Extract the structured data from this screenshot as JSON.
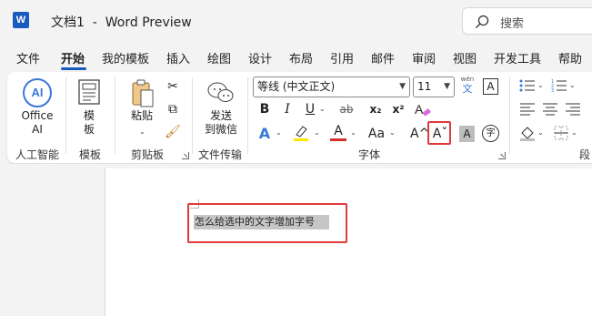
{
  "titlebar": {
    "logo_letter": "W",
    "title": "文档1  -  Word Preview",
    "search_placeholder": "搜索"
  },
  "tabs": [
    "文件",
    "开始",
    "我的模板",
    "插入",
    "绘图",
    "设计",
    "布局",
    "引用",
    "邮件",
    "审阅",
    "视图",
    "开发工具",
    "帮助"
  ],
  "active_tab": "开始",
  "ribbon": {
    "ai": {
      "button_label_line1": "Office",
      "button_label_line2": "AI",
      "group": "人工智能",
      "icon_text": "AI"
    },
    "template": {
      "button_label_line1": "模",
      "button_label_line2": "板",
      "group": "模板"
    },
    "clipboard": {
      "paste_label": "粘贴",
      "group": "剪贴板"
    },
    "transfer": {
      "button_label_line1": "发送",
      "button_label_line2": "到微信",
      "group": "文件传输"
    },
    "font": {
      "font_name": "等线 (中文正文)",
      "font_size": "11",
      "phonetic_top": "wén",
      "phonetic_bottom": "文",
      "char_border": "A",
      "bold": "B",
      "italic": "I",
      "underline": "U",
      "strike": "ab",
      "subscript": "x₂",
      "superscript": "x²",
      "grow_font": "A^",
      "shrink_font": "Aˇ",
      "shading_letter": "A",
      "enclose_char": "字",
      "group": "字体"
    },
    "paragraph": {
      "group": "段"
    }
  },
  "document": {
    "selected_text": "怎么给选中的文字增加字号"
  },
  "colors": {
    "accent": "#185abd",
    "highlight": "#e03a3a",
    "selection": "#c6c6c6",
    "text_effect_blue": "#3a78d8",
    "highlighter_yellow": "#ffe600",
    "font_red": "#d32f2f"
  }
}
